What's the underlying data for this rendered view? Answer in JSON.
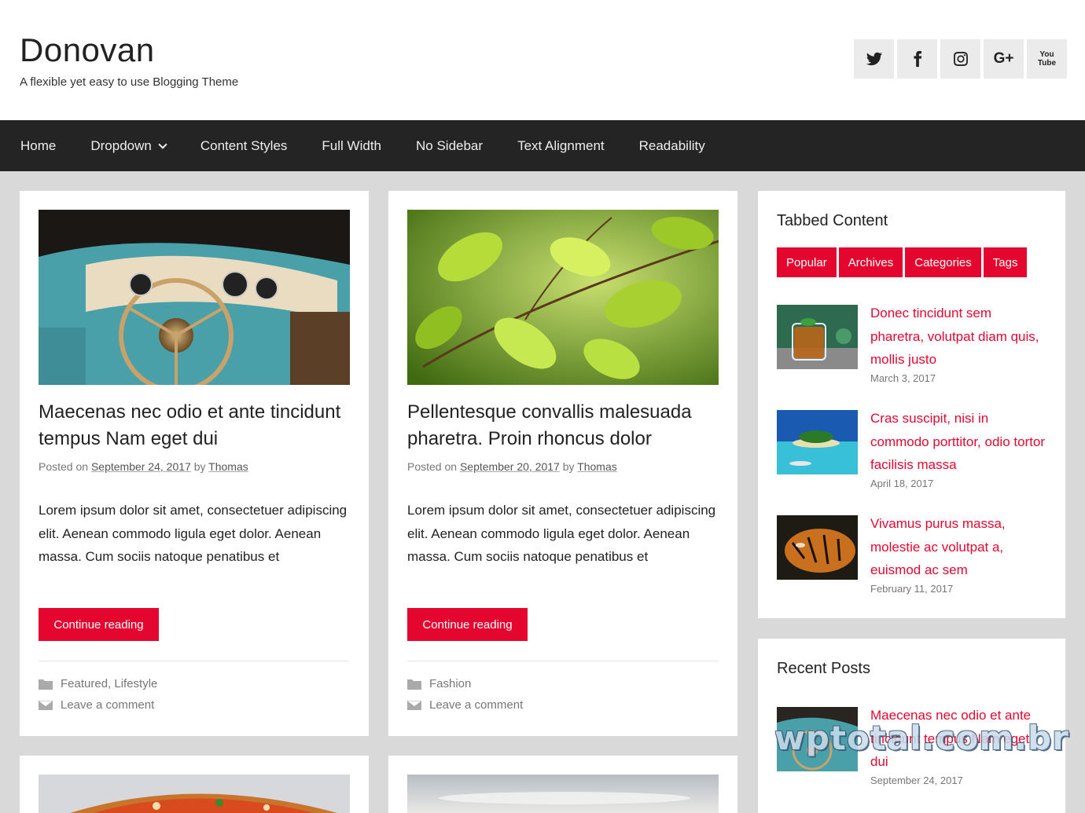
{
  "header": {
    "title": "Donovan",
    "description": "A flexible yet easy to use Blogging Theme",
    "social": [
      {
        "name": "twitter-icon"
      },
      {
        "name": "facebook-icon"
      },
      {
        "name": "instagram-icon"
      },
      {
        "name": "google-plus-icon",
        "label": "G+"
      },
      {
        "name": "youtube-icon",
        "label": "You Tube"
      }
    ]
  },
  "nav": {
    "items": [
      "Home",
      "Dropdown",
      "Content Styles",
      "Full Width",
      "No Sidebar",
      "Text Alignment",
      "Readability"
    ]
  },
  "posts": [
    {
      "title": "Maecenas nec odio et ante tincidunt tempus Nam eget dui",
      "posted_on": "Posted on",
      "date": "September 24, 2017",
      "by": "by",
      "author": "Thomas",
      "excerpt": "Lorem ipsum dolor sit amet, consectetuer adipiscing elit. Aenean commodo ligula eget dolor. Aenean massa. Cum sociis natoque penatibus et",
      "button": "Continue reading",
      "categories": "Featured, Lifestyle",
      "comments": "Leave a comment"
    },
    {
      "title": "Pellentesque convallis malesuada pharetra. Proin rhoncus dolor",
      "posted_on": "Posted on",
      "date": "September 20, 2017",
      "by": "by",
      "author": "Thomas",
      "excerpt": "Lorem ipsum dolor sit amet, consectetuer adipiscing elit. Aenean commodo ligula eget dolor. Aenean massa. Cum sociis natoque penatibus et",
      "button": "Continue reading",
      "categories": "Fashion",
      "comments": "Leave a comment"
    }
  ],
  "sidebar": {
    "tabbed": {
      "title": "Tabbed Content",
      "tabs": [
        "Popular",
        "Archives",
        "Categories",
        "Tags"
      ],
      "posts": [
        {
          "title": "Donec tincidunt sem pharetra, volutpat diam quis, mollis justo",
          "date": "March 3, 2017"
        },
        {
          "title": "Cras suscipit, nisi in commodo porttitor, odio tortor facilisis massa",
          "date": "April 18, 2017"
        },
        {
          "title": "Vivamus purus massa, molestie ac volutpat a, euismod ac sem",
          "date": "February 11, 2017"
        }
      ]
    },
    "recent": {
      "title": "Recent Posts",
      "posts": [
        {
          "title": "Maecenas nec odio et ante tincidunt tempus Nam eget dui",
          "date": "September 24, 2017"
        }
      ]
    }
  },
  "watermark": "wptotal.com.br",
  "colors": {
    "accent": "#e5062f",
    "nav_bg": "#242424",
    "page_bg": "#d9d9d9"
  }
}
